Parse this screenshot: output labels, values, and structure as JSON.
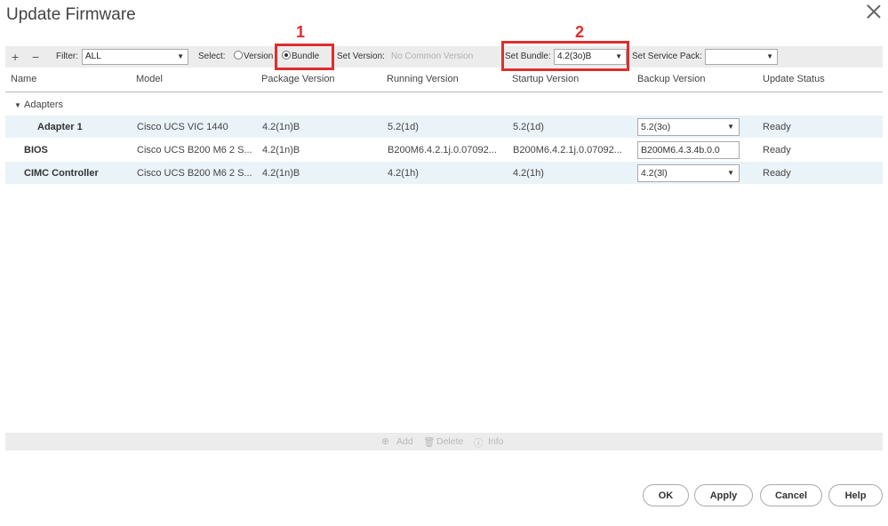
{
  "dialog": {
    "title": "Update Firmware",
    "close_icon": "close-icon"
  },
  "toolbar": {
    "add_symbol": "+",
    "remove_symbol": "−",
    "filter_label": "Filter:",
    "filter_value": "ALL",
    "select_label": "Select:",
    "version_option": "Version",
    "bundle_option": "Bundle",
    "selected_option": "Bundle",
    "set_version_label": "Set Version:",
    "set_version_value": "No Common Version",
    "set_bundle_label": "Set Bundle:",
    "set_bundle_value": "4.2(3o)B",
    "set_service_pack_label": "Set Service Pack:",
    "set_service_pack_value": ""
  },
  "annotations": {
    "marker1": "1",
    "marker2": "2",
    "color": "#e02d2d"
  },
  "table": {
    "columns": [
      "Name",
      "Model",
      "Package Version",
      "Running Version",
      "Startup Version",
      "Backup Version",
      "Update Status"
    ],
    "group": "Adapters",
    "rows": [
      {
        "name": "Adapter 1",
        "model": "Cisco UCS VIC 1440",
        "package": "4.2(1n)B",
        "running": "5.2(1d)",
        "startup": "5.2(1d)",
        "backup": "5.2(3o)",
        "status": "Ready"
      },
      {
        "name": "BIOS",
        "model": "Cisco UCS B200 M6 2 S...",
        "package": "4.2(1n)B",
        "running": "B200M6.4.2.1j.0.07092...",
        "startup": "B200M6.4.2.1j.0.07092...",
        "backup": "B200M6.4.3.4b.0.0",
        "status": "Ready"
      },
      {
        "name": "CIMC Controller",
        "model": "Cisco UCS B200 M6 2 S...",
        "package": "4.2(1n)B",
        "running": "4.2(1h)",
        "startup": "4.2(1h)",
        "backup": "4.2(3l)",
        "status": "Ready"
      }
    ]
  },
  "footer_toolbar": {
    "add": "Add",
    "delete": "Delete",
    "info": "Info"
  },
  "buttons": {
    "ok": "OK",
    "apply": "Apply",
    "cancel": "Cancel",
    "help": "Help"
  }
}
